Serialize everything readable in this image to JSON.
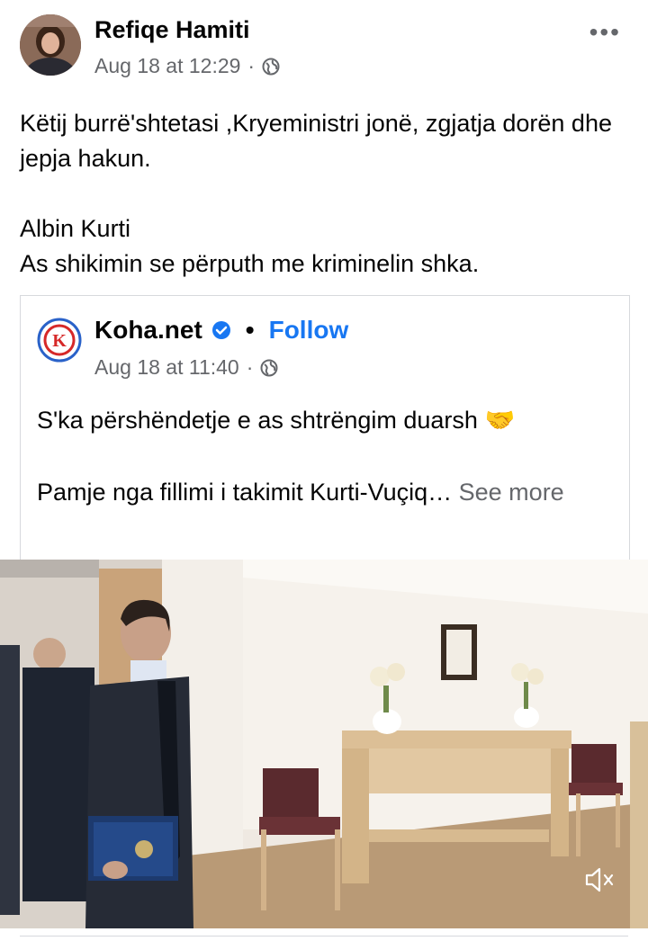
{
  "post": {
    "author": "Refiqe Hamiti",
    "timestamp": "Aug 18 at 12:29",
    "separator": "·",
    "audience_icon": "globe-icon",
    "more_label": "•••",
    "text_line1": "Këtij burrë'shtetasi ,Kryeministri jonë, zgjatja dorën dhe jepja hakun.",
    "text_line2": "Albin Kurti",
    "text_line3": "As shikimin se përputh me kriminelin shka."
  },
  "shared": {
    "page_name": "Koha.net",
    "verified_icon": "verified-badge-icon",
    "dot": "•",
    "follow_label": "Follow",
    "timestamp": "Aug 18 at 11:40",
    "separator": "·",
    "text_line1": "S'ka përshëndetje e as shtrëngim duarsh 🤝",
    "text_line2": "Pamje nga fillimi i takimit Kurti-Vuçiq…",
    "see_more": "See more"
  },
  "video": {
    "mute_icon": "speaker-muted-icon"
  },
  "colors": {
    "link_blue": "#1877f2",
    "meta_gray": "#65676b",
    "border": "#d7d9dd"
  }
}
